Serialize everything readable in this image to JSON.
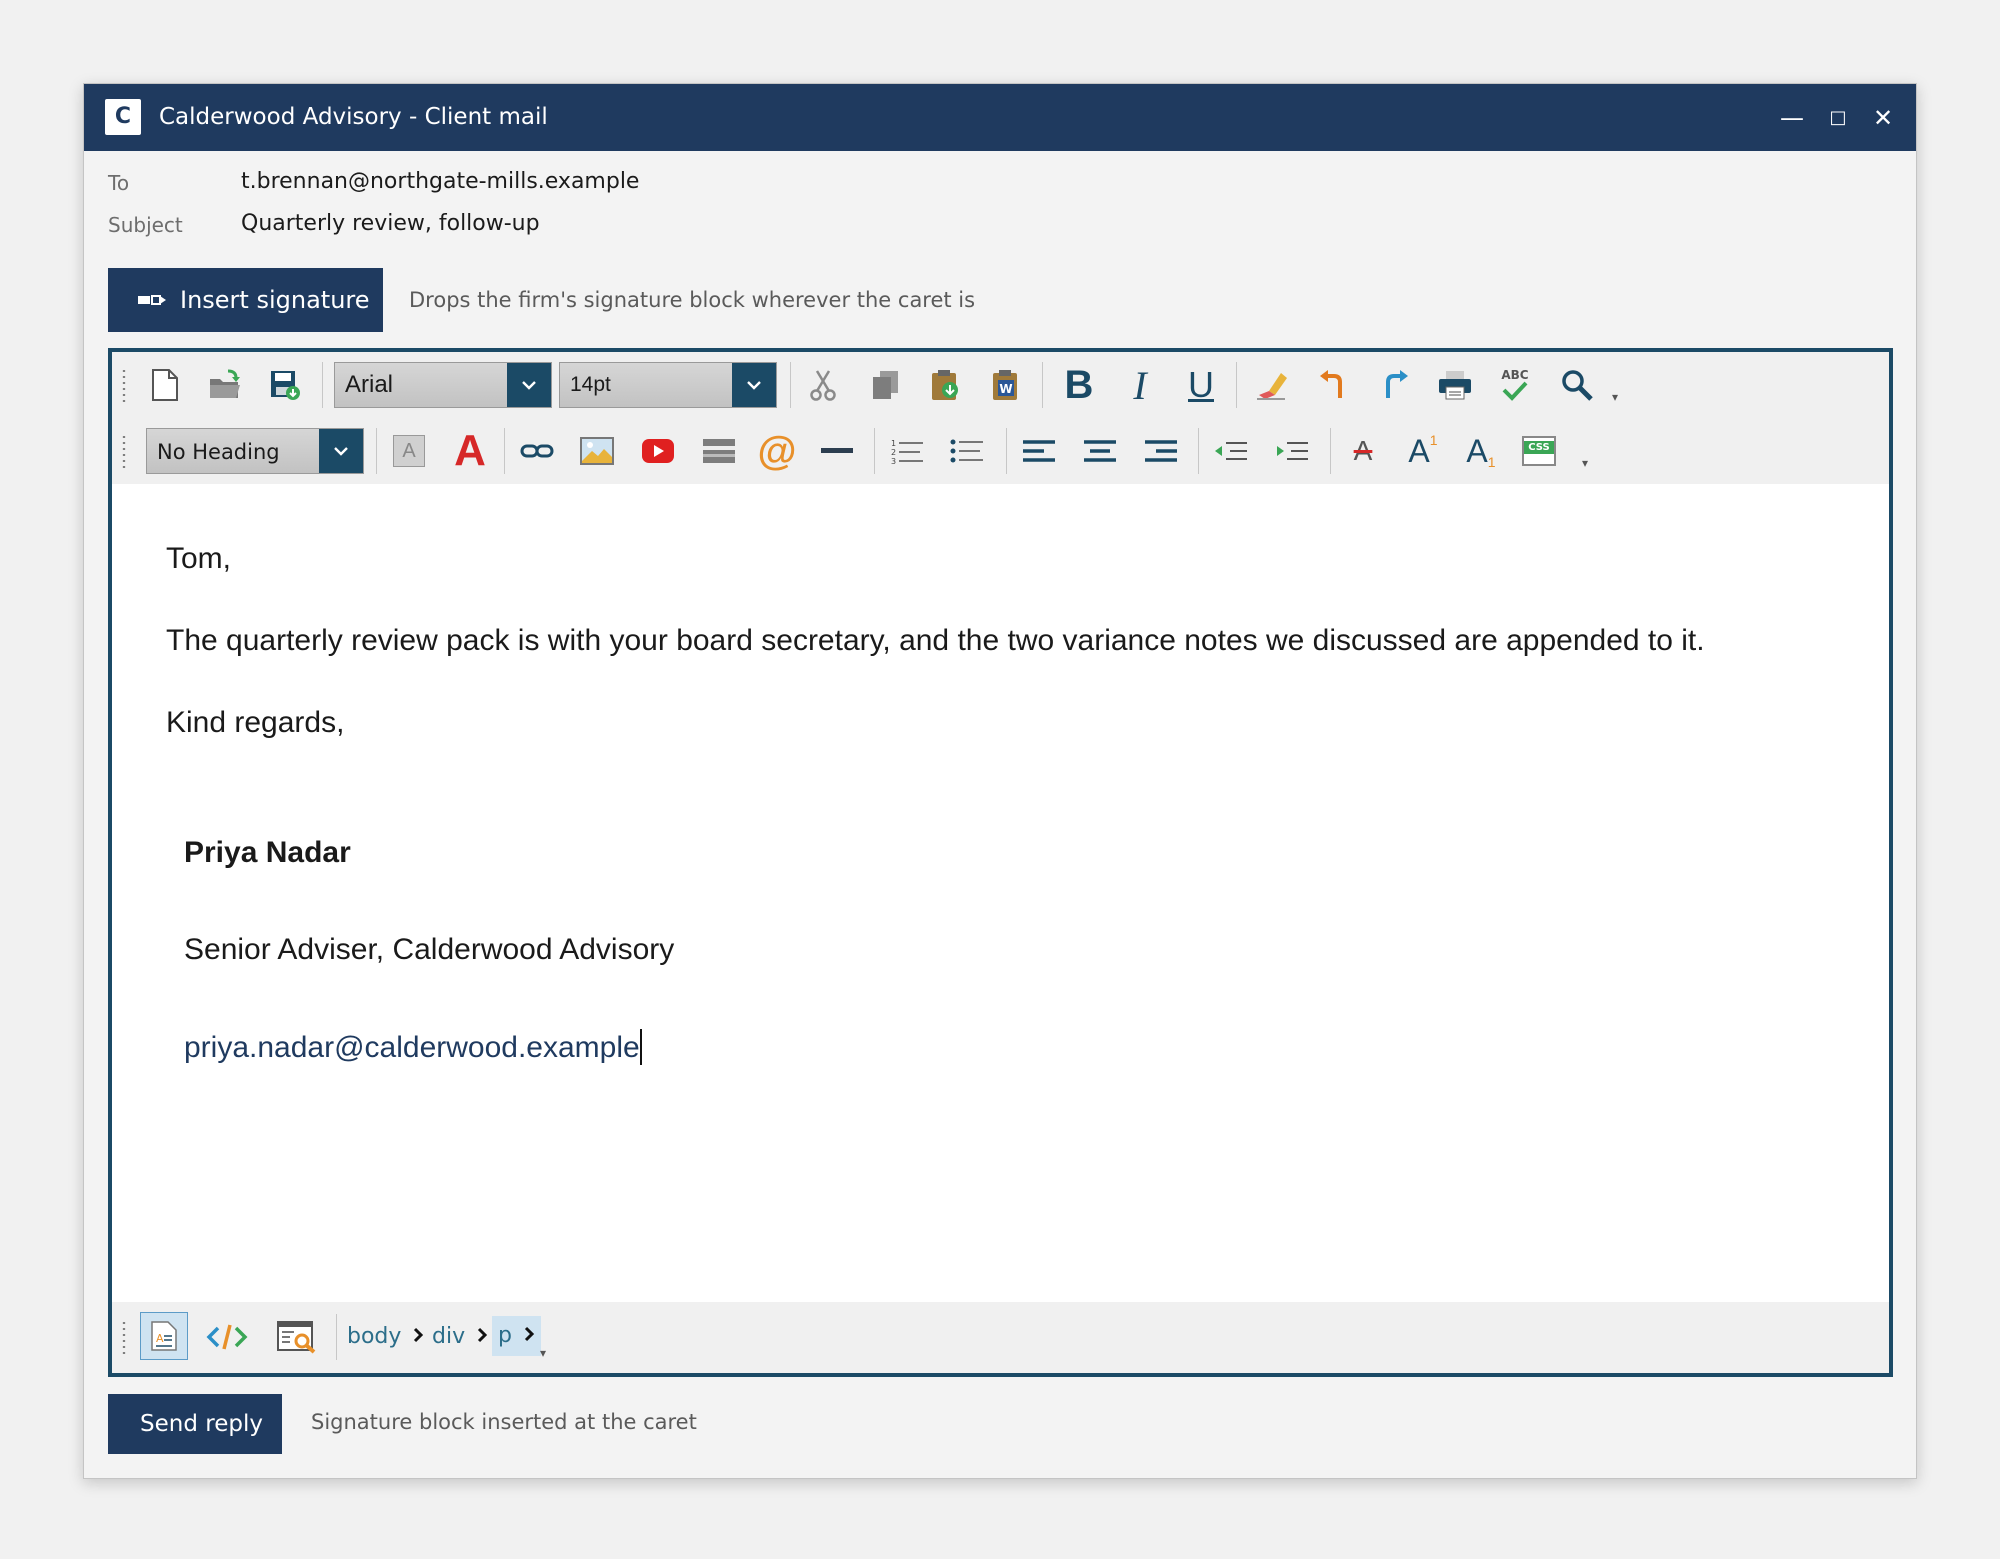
{
  "window": {
    "app_letter": "C",
    "title": "Calderwood Advisory - Client mail",
    "controls": {
      "minimize": "—",
      "maximize": "□",
      "close": "✕"
    }
  },
  "header": {
    "to_label": "To",
    "to_value": "t.brennan@northgate-mills.example",
    "subject_label": "Subject",
    "subject_value": "Quarterly review, follow-up"
  },
  "signature_action": {
    "button_label": "Insert signature",
    "hint": "Drops the firm's signature block wherever the caret is"
  },
  "toolbar1": {
    "font_family": "Arial",
    "font_size": "14pt",
    "icons": [
      "new-document-icon",
      "open-folder-icon",
      "save-icon",
      "cut-icon",
      "copy-icon",
      "paste-icon",
      "paste-from-word-icon",
      "bold-icon",
      "italic-icon",
      "underline-icon",
      "eraser-icon",
      "undo-icon",
      "redo-icon",
      "print-icon",
      "spellcheck-icon",
      "find-icon"
    ],
    "bold_glyph": "B",
    "italic_glyph": "I",
    "underline_glyph": "U",
    "spell_text": "ABC"
  },
  "toolbar2": {
    "heading": "No Heading",
    "highlight_glyph": "A",
    "font_color_glyph": "A",
    "at_glyph": "@",
    "strike_glyph": "A",
    "superscript_glyph": "A",
    "superscript_mark": "1",
    "subscript_glyph": "A",
    "subscript_mark": "1",
    "css_text": "CSS"
  },
  "body": {
    "greeting": "Tom,",
    "paragraph": "The quarterly review pack is with your board secretary, and the two variance notes we discussed are appended to it.",
    "closing": "Kind regards,",
    "signature_name": "Priya Nadar",
    "signature_title": "Senior Adviser, Calderwood Advisory",
    "signature_email": "priya.nadar@calderwood.example"
  },
  "statusbar": {
    "breadcrumbs": [
      "body",
      "div",
      "p"
    ]
  },
  "footer": {
    "send_label": "Send reply",
    "status": "Signature block inserted at the caret"
  },
  "colors": {
    "brand": "#1f3a5f",
    "editor_border": "#1b4a66",
    "link": "#2c6e8a"
  }
}
